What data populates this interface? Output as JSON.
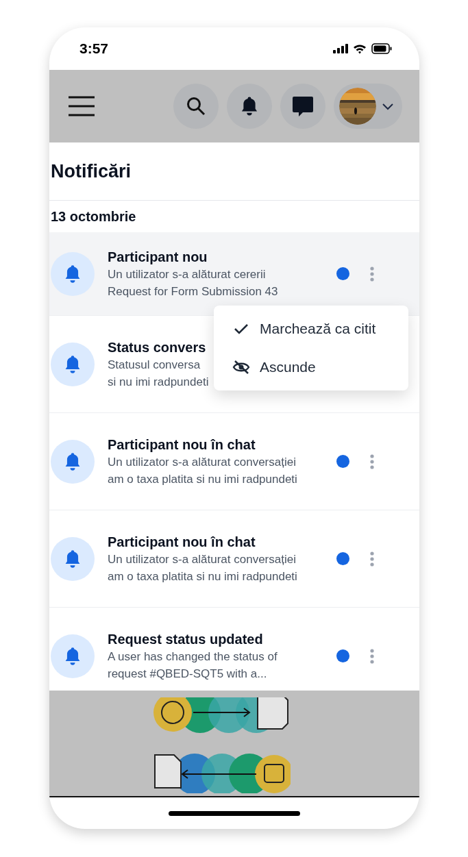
{
  "status_bar": {
    "time": "3:57"
  },
  "panel": {
    "title": "Notificări",
    "date": "13 octombrie"
  },
  "notifications": [
    {
      "title": "Participant nou",
      "lines": [
        "Un utilizator s-a alăturat cererii",
        "Request for Form Submission 43"
      ],
      "unread": true,
      "selected": true
    },
    {
      "title": "Status convers",
      "lines": [
        "Statusul conversa",
        "si nu imi radpundeti"
      ],
      "selected": false
    },
    {
      "title": "Participant nou în chat",
      "lines": [
        "Un utilizator s-a alăturat conversației",
        "am o taxa platita si nu imi radpundeti"
      ],
      "unread": true,
      "selected": false
    },
    {
      "title": "Participant nou în chat",
      "lines": [
        "Un utilizator s-a alăturat conversației",
        "am o taxa platita si nu imi radpundeti"
      ],
      "unread": true,
      "selected": false
    },
    {
      "title": "Request status updated",
      "lines": [
        "A user has changed the status of",
        "request #QBED-SQT5 with a..."
      ],
      "unread": true,
      "selected": false
    }
  ],
  "context_menu": {
    "items": [
      {
        "kind": "check",
        "label": "Marchează ca citit"
      },
      {
        "kind": "hide",
        "label": "Ascunde"
      }
    ]
  }
}
